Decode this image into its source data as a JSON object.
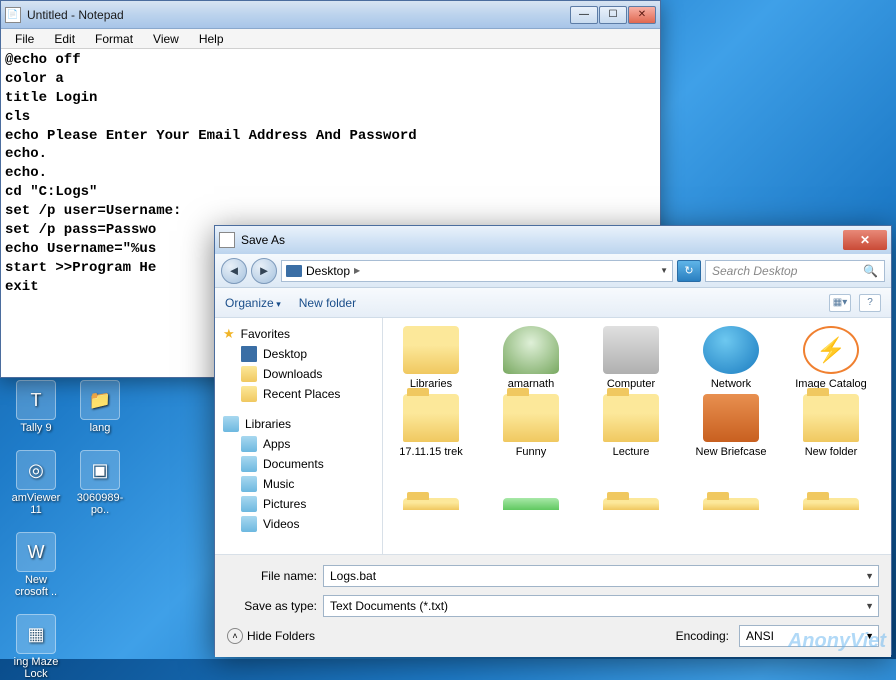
{
  "notepad": {
    "title": "Untitled - Notepad",
    "menu": {
      "file": "File",
      "edit": "Edit",
      "format": "Format",
      "view": "View",
      "help": "Help"
    },
    "content": "@echo off\ncolor a\ntitle Login\ncls\necho Please Enter Your Email Address And Password\necho.\necho.\ncd \"C:Logs\"\nset /p user=Username:\nset /p pass=Passwo\necho Username=\"%us\nstart >>Program He\nexit"
  },
  "saveas": {
    "title": "Save As",
    "breadcrumb": "Desktop",
    "search_placeholder": "Search Desktop",
    "organize": "Organize",
    "new_folder": "New folder",
    "sidebar": {
      "favorites": "Favorites",
      "fav_items": [
        {
          "label": "Desktop",
          "icon": "desktop"
        },
        {
          "label": "Downloads",
          "icon": "folder"
        },
        {
          "label": "Recent Places",
          "icon": "folder"
        }
      ],
      "libraries": "Libraries",
      "lib_items": [
        {
          "label": "Apps",
          "icon": "lib"
        },
        {
          "label": "Documents",
          "icon": "lib"
        },
        {
          "label": "Music",
          "icon": "lib"
        },
        {
          "label": "Pictures",
          "icon": "lib"
        },
        {
          "label": "Videos",
          "icon": "lib"
        }
      ]
    },
    "files": [
      {
        "label": "Libraries",
        "kind": "libraries"
      },
      {
        "label": "amarnath",
        "kind": "user"
      },
      {
        "label": "Computer",
        "kind": "computer"
      },
      {
        "label": "Network",
        "kind": "network"
      },
      {
        "label": "Image Catalog",
        "kind": "catalog"
      },
      {
        "label": "17.11.15 trek",
        "kind": "folder"
      },
      {
        "label": "Funny",
        "kind": "folder"
      },
      {
        "label": "Lecture",
        "kind": "folder"
      },
      {
        "label": "New Briefcase",
        "kind": "briefcase"
      },
      {
        "label": "New folder",
        "kind": "folder"
      },
      {
        "label": "",
        "kind": "folder partial"
      },
      {
        "label": "",
        "kind": "funny partial"
      },
      {
        "label": "",
        "kind": "folder partial"
      },
      {
        "label": "",
        "kind": "folder partial"
      },
      {
        "label": "",
        "kind": "folder partial"
      }
    ],
    "filename_label": "File name:",
    "filename_value": "Logs.bat",
    "savetype_label": "Save as type:",
    "savetype_value": "Text Documents (*.txt)",
    "hide_folders": "Hide Folders",
    "encoding_label": "Encoding:",
    "encoding_value": "ANSI"
  },
  "desktop": {
    "col1": [
      {
        "label": "Tally 9",
        "glyph": "T"
      },
      {
        "label": "amViewer 11",
        "glyph": "◎"
      },
      {
        "label": "New crosoft ..",
        "glyph": "W"
      },
      {
        "label": "ing Maze Lock",
        "glyph": "▦"
      }
    ],
    "col2": [
      {
        "label": "lang",
        "glyph": "📁"
      },
      {
        "label": "3060989-po..",
        "glyph": "▣"
      }
    ]
  },
  "watermark": "AnonyViet"
}
